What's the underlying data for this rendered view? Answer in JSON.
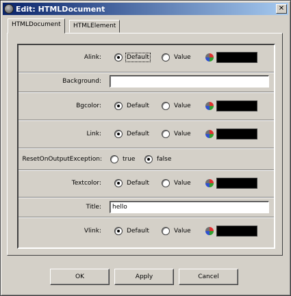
{
  "window": {
    "title": "Edit: HTMLDocument",
    "close_glyph": "✕"
  },
  "tabs": [
    {
      "label": "HTMLDocument",
      "active": true
    },
    {
      "label": "HTMLElement",
      "active": false
    }
  ],
  "properties": {
    "alink": {
      "label": "Alink:",
      "options": [
        "Default",
        "Value"
      ],
      "selected": "Default",
      "color": "#000000"
    },
    "background": {
      "label": "Background:",
      "value": ""
    },
    "bgcolor": {
      "label": "Bgcolor:",
      "options": [
        "Default",
        "Value"
      ],
      "selected": "Default",
      "color": "#000000"
    },
    "link": {
      "label": "Link:",
      "options": [
        "Default",
        "Value"
      ],
      "selected": "Default",
      "color": "#000000"
    },
    "reset_on_output_exception": {
      "label": "ResetOnOutputException:",
      "options": [
        "true",
        "false"
      ],
      "selected": "false"
    },
    "textcolor": {
      "label": "Textcolor:",
      "options": [
        "Default",
        "Value"
      ],
      "selected": "Default",
      "color": "#000000"
    },
    "title": {
      "label": "Title:",
      "value": "hello"
    },
    "vlink": {
      "label": "Vlink:",
      "options": [
        "Default",
        "Value"
      ],
      "selected": "Default",
      "color": "#000000"
    }
  },
  "icons": {
    "color_picker": "color-picker-icon",
    "app": "app-icon"
  },
  "buttons": {
    "ok": "OK",
    "apply": "Apply",
    "cancel": "Cancel"
  }
}
